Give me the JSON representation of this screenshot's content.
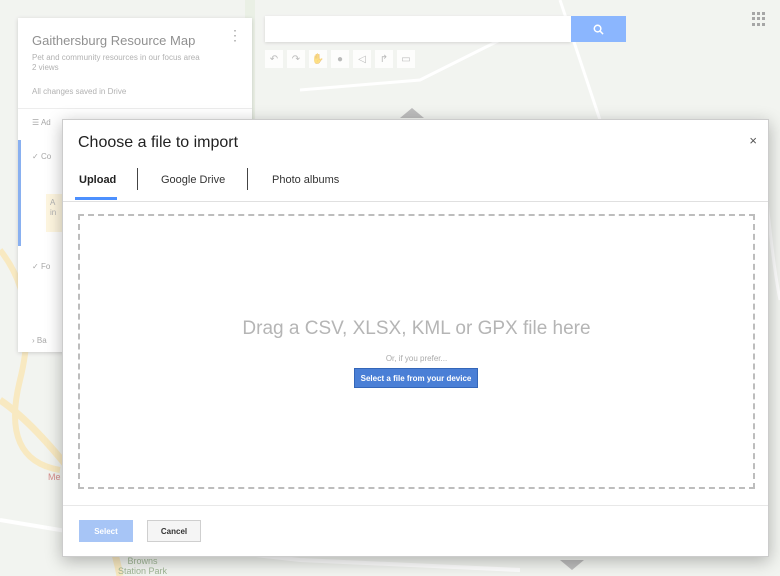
{
  "map_panel": {
    "title": "Gaithersburg Resource Map",
    "description": "Pet and community resources in our focus area",
    "views": "2 views",
    "saved_status": "All changes saved in Drive",
    "layer_1_label": "Ad",
    "layer_2_label": "Co",
    "layer_3_label": "Fo",
    "base_label": "Ba",
    "warn_text": "A in"
  },
  "map_labels": {
    "park": "Browns\nStation Park",
    "place": "Me"
  },
  "search": {
    "placeholder": ""
  },
  "toolbar_icons": [
    "undo-icon",
    "redo-icon",
    "hand-icon",
    "marker-icon",
    "shape-icon",
    "route-icon",
    "ruler-icon"
  ],
  "dialog": {
    "title": "Choose a file to import",
    "close_glyph": "×",
    "tabs": [
      {
        "label": "Upload",
        "active": true
      },
      {
        "label": "Google Drive",
        "active": false
      },
      {
        "label": "Photo albums",
        "active": false
      }
    ],
    "drop_text": "Drag a CSV, XLSX, KML or GPX file here",
    "or_text": "Or, if you prefer...",
    "device_button": "Select a file from your device",
    "select_button": "Select",
    "cancel_button": "Cancel"
  },
  "colors": {
    "accent": "#4d90fe",
    "device_button": "#4a7fd6",
    "select_disabled": "#a7c5f6"
  }
}
